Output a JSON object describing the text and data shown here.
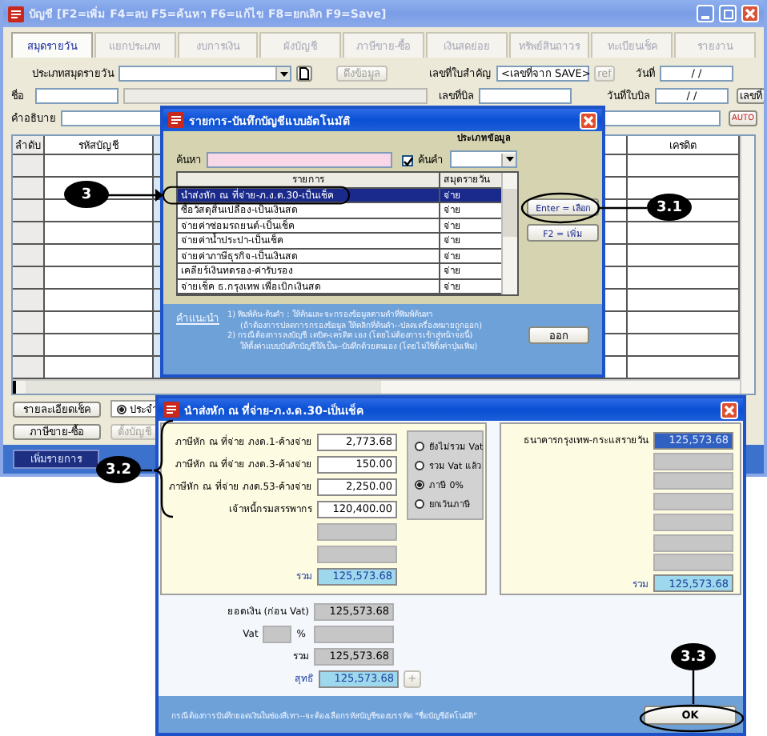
{
  "main_window": {
    "title": "บัญชี  [F2=เพิ่ม  F4=ลบ  F5=ค้นหา  F6=แก้ไข  F8=ยกเลิก  F9=Save]",
    "tabs": [
      {
        "label": "สมุดรายวัน",
        "selected": true
      },
      {
        "label": "แยกประเภท",
        "selected": false
      },
      {
        "label": "งบการเงิน",
        "selected": false
      },
      {
        "label": "ผังบัญชี",
        "selected": false
      },
      {
        "label": "ภาษีขาย-ซื้อ",
        "selected": false
      },
      {
        "label": "เงินสดย่อย",
        "selected": false
      },
      {
        "label": "ทรัพย์สินถาวร",
        "selected": false
      },
      {
        "label": "ทะเบียนเช็ค",
        "selected": false
      },
      {
        "label": "รายงาน",
        "selected": false
      }
    ],
    "form": {
      "journal_type_label": "ประเภทสมุดรายวัน",
      "copy_button": {
        "label": "ดึงข้อมูล",
        "disabled": true
      },
      "voucher_no_label": "เลขที่ใบสำคัญ",
      "voucher_no_value": "<เลขที่จาก SAVE>",
      "ref_button": {
        "label": "ref",
        "disabled": true
      },
      "date_label": "วันที่",
      "date_value": "/ /",
      "name_label": "ชื่อ",
      "bill_no_label": "เลขที่บิล",
      "bill_date_label": "วันที่ใบบิล",
      "bill_date_value": "/ /",
      "number_button": "เลขที่",
      "description_label": "คำอธิบาย",
      "auto_button": "AUTO"
    },
    "grid": {
      "columns": [
        "ลำดับ",
        "รหัสบัญชี",
        "เครดิต"
      ]
    },
    "bottom": {
      "buttons": [
        "รายละเอียดเช็ค",
        "ภาษีขาย-ซื้อ"
      ],
      "radio": {
        "label": "ประจำ",
        "selected": true
      },
      "post_button": {
        "label": "ตั้งบัญชี",
        "disabled": true
      },
      "add_button": "เพิ่มรายการ"
    }
  },
  "list_dialog": {
    "title": "รายการ-บันทึกบัญชีแบบอัตโนมัติ",
    "search_label": "ค้นหา",
    "filter_checkbox": {
      "label": "ค้นคำ",
      "checked": true
    },
    "type_label": "ประเภทข้อมูล",
    "columns": [
      "รายการ",
      "สมุดรายวัน"
    ],
    "rows": [
      {
        "item": "นำส่งหัก ณ ที่จ่าย-ภ.ง.ด.30-เป็นเช็ค",
        "journal": "จ่าย",
        "selected": true
      },
      {
        "item": "ซื้อวัสดุสิ้นเปลือง-เป็นเงินสด",
        "journal": "จ่าย",
        "selected": false
      },
      {
        "item": "จ่ายค่าซ่อมรถยนต์-เป็นเช็ค",
        "journal": "จ่าย",
        "selected": false
      },
      {
        "item": "จ่ายค่าน้ำประปา-เป็นเช็ค",
        "journal": "จ่าย",
        "selected": false
      },
      {
        "item": "จ่ายค่าภาษีธุรกิจ-เป็นเงินสด",
        "journal": "จ่าย",
        "selected": false
      },
      {
        "item": "เคลียร์เงินทดรอง-ค่ารับรอง",
        "journal": "จ่าย",
        "selected": false
      },
      {
        "item": "จ่ายเช็ค ธ.กรุงเทพ เพื่อเบิกเงินสด",
        "journal": "จ่าย",
        "selected": false
      }
    ],
    "buttons": [
      "Enter = เลือก",
      "F2 = เพิ่ม"
    ],
    "hint_title": "คำแนะนำ",
    "hints": [
      {
        "kind": "item",
        "text": "1) พิมพ์ค้น-ค้นคำ : ให้ค้นและจะกรองข้อมูลตามคำที่พิมพ์ค้นหา"
      },
      {
        "kind": "continuation",
        "text": "(ถ้าต้องการปลดการกรองข้อมูล ให้คลิกที่ค้นคำ--ปลดเครื่องหมายถูกออก)"
      },
      {
        "kind": "item",
        "text": "2) กรณีต้องการลงบัญชี เดบิต-เครดิต เอง (โดยไม่ต้องการเข้าสู่หน้าจอนี้)"
      },
      {
        "kind": "continuation",
        "text": "ให้ตั้งค่าแบบบันทึกบัญชีให้เป็น--บันทึกด้วยตนเอง (โดยไม่ใช้ตั้งค่าปุ่มเพิ่ม)"
      }
    ],
    "exit_button": "ออก"
  },
  "posting_dialog": {
    "title": "นำส่งหัก ณ ที่จ่าย-ภ.ง.ด.30-เป็นเช็ค",
    "debit_lines": [
      {
        "kind": "entry",
        "label": "ภาษีหัก ณ ที่จ่าย ภงด.1-ค้างจ่าย",
        "amount": "2,773.68"
      },
      {
        "kind": "entry",
        "label": "ภาษีหัก ณ ที่จ่าย ภงด.3-ค้างจ่าย",
        "amount": "150.00"
      },
      {
        "kind": "entry",
        "label": "ภาษีหัก ณ ที่จ่าย ภงด.53-ค้างจ่าย",
        "amount": "2,250.00"
      },
      {
        "kind": "entry",
        "label": "เจ้าหนี้กรมสรรพากร",
        "amount": "120,400.00"
      },
      {
        "kind": "blank"
      },
      {
        "kind": "blank"
      }
    ],
    "debit_total": {
      "label": "รวม",
      "amount": "125,573.68"
    },
    "vat_options": [
      {
        "label": "ยังไม่รวม Vat",
        "selected": false
      },
      {
        "label": "รวม Vat แล้ว",
        "selected": false
      },
      {
        "label": "ภาษี 0%",
        "selected": true
      },
      {
        "label": "ยกเว้นภาษี",
        "selected": false
      }
    ],
    "credit_lines": [
      {
        "kind": "entry",
        "label": "ธนาคารกรุงเทพ-กระแสรายวัน",
        "amount": "125,573.68",
        "focused": true
      },
      {
        "kind": "blank",
        "focused": false
      },
      {
        "kind": "blank",
        "focused": false
      },
      {
        "kind": "blank",
        "focused": false
      },
      {
        "kind": "blank",
        "focused": false
      },
      {
        "kind": "blank",
        "focused": false
      },
      {
        "kind": "blank",
        "focused": false
      }
    ],
    "credit_total": {
      "label": "รวม",
      "amount": "125,573.68"
    },
    "summary": {
      "subtotal_label": "ยอดเงิน (ก่อน Vat)",
      "subtotal": "125,573.68",
      "vat_label": "Vat",
      "percent_sign": "%",
      "total_label": "รวม",
      "total": "125,573.68",
      "net_label": "สุทธิ",
      "net": "125,573.68",
      "plus_button": "+"
    },
    "footer_note": "กรณีต้องการบันทึกยอดเงินในช่องสีเทา--จะต้องเลือกรหัสบัญชีของบรรทัด \"ชื่อบัญชีอัตโนมัติ\"",
    "ok_button": "OK"
  },
  "callouts": [
    {
      "label": "3"
    },
    {
      "label": "3.1"
    },
    {
      "label": "3.2"
    },
    {
      "label": "3.3"
    }
  ]
}
